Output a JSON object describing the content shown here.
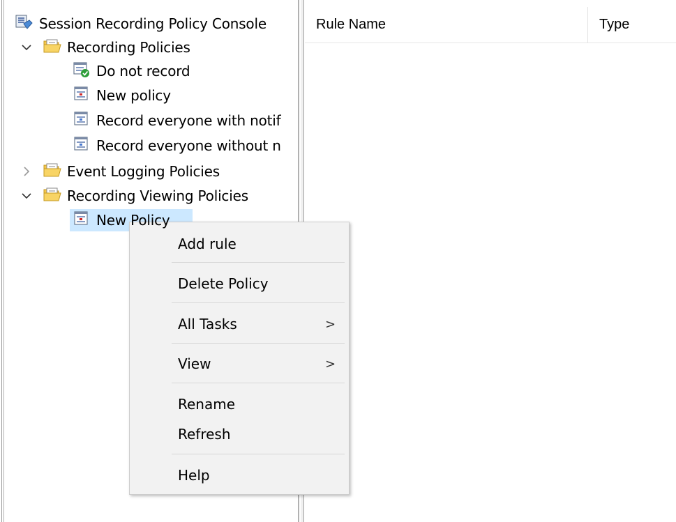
{
  "tree": {
    "root": {
      "label": "Session Recording Policy Console",
      "icon": "console-icon"
    },
    "recording_policies": {
      "label": "Recording Policies",
      "expanded": true,
      "items": [
        {
          "label": "Do not record",
          "icon": "policy-active-icon"
        },
        {
          "label": "New policy",
          "icon": "policy-icon"
        },
        {
          "label": "Record everyone with notif",
          "icon": "policy-icon"
        },
        {
          "label": "Record everyone without n",
          "icon": "policy-icon"
        }
      ]
    },
    "event_logging_policies": {
      "label": "Event Logging Policies",
      "expanded": false
    },
    "recording_viewing_policies": {
      "label": "Recording Viewing Policies",
      "expanded": true,
      "items": [
        {
          "label": "New Policy",
          "icon": "policy-icon",
          "selected": true
        }
      ]
    }
  },
  "list": {
    "columns": [
      "Rule Name",
      "Type"
    ]
  },
  "context_menu": {
    "items": [
      {
        "label": "Add rule"
      },
      {
        "label": "Delete Policy"
      },
      {
        "label": "All Tasks",
        "submenu": true,
        "arrow": ">"
      },
      {
        "label": "View",
        "submenu": true,
        "arrow": ">"
      },
      {
        "label": "Rename"
      },
      {
        "label": "Refresh"
      },
      {
        "label": "Help"
      }
    ]
  },
  "colors": {
    "selection": "#cce8ff",
    "menu_bg": "#f2f2f2",
    "folder": "#f5c74d"
  }
}
